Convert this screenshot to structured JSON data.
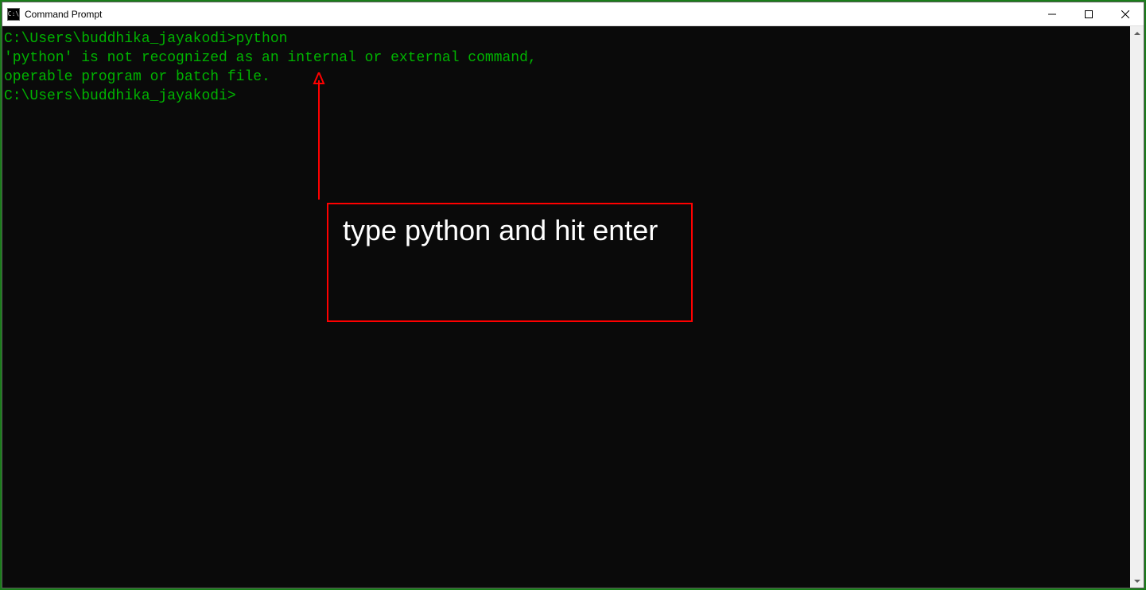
{
  "window": {
    "title": "Command Prompt",
    "icon_label": "C:\\"
  },
  "terminal": {
    "lines": [
      "",
      "C:\\Users\\buddhika_jayakodi>python",
      "'python' is not recognized as an internal or external command,",
      "operable program or batch file.",
      "",
      "C:\\Users\\buddhika_jayakodi>"
    ]
  },
  "annotation": {
    "text": "type python and hit enter"
  },
  "colors": {
    "terminal_bg": "#0a0a0a",
    "terminal_text": "#00b300",
    "annotation_border": "#ff0000",
    "annotation_text": "#ffffff"
  }
}
